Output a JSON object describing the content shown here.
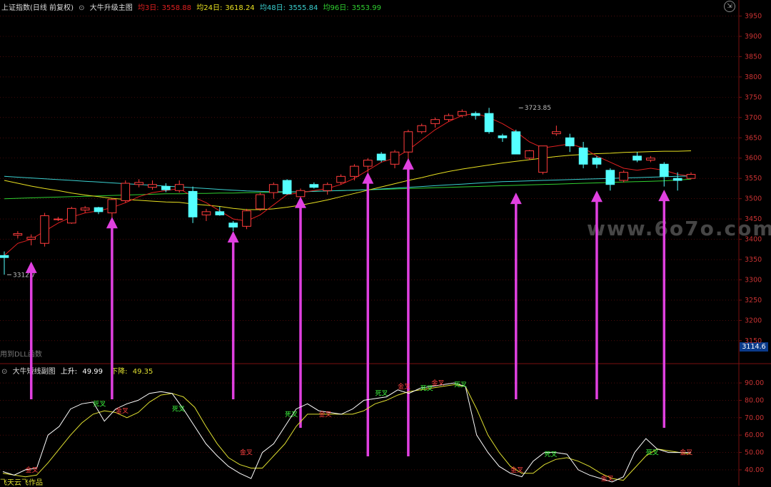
{
  "header": {
    "symbol": "上证指数(日线 前复权)",
    "indicator_main": "大牛升级主图",
    "ma3_label": "均3日:",
    "ma3_value": "3558.88",
    "ma24_label": "均24日:",
    "ma24_value": "3618.24",
    "ma48_label": "均48日:",
    "ma48_value": "3555.84",
    "ma96_label": "均96日:",
    "ma96_value": "3553.99"
  },
  "sub_header": {
    "indicator_sub": "大牛短线副图",
    "up_label": "上升:",
    "up_value": "49.99",
    "down_label": "下降:",
    "down_value": "49.35"
  },
  "watermark": "www.6o7o.com",
  "dll_note": "用到DLL函数",
  "author": "飞天云飞作品",
  "current_price_badge": "3114.6",
  "colors": {
    "up": "#ff3c3c",
    "down": "#54ffff",
    "ma3": "#e02020",
    "ma24": "#e8e020",
    "ma48": "#3ad0d0",
    "ma96": "#30d030",
    "sub_up": "#ffffff",
    "sub_down": "#e0e030",
    "arrow": "#e040e0",
    "grid": "#7a1010"
  },
  "chart_data": [
    {
      "type": "candlestick",
      "y_ticks": [
        3150,
        3200,
        3250,
        3300,
        3350,
        3400,
        3450,
        3500,
        3550,
        3600,
        3650,
        3700,
        3750,
        3800,
        3850,
        3900,
        3950
      ],
      "ylim": [
        3114.6,
        3965
      ],
      "grid": true,
      "annotations": [
        {
          "text": "3723.85",
          "x": 38,
          "y": 3723.85
        },
        {
          "text": "3312.7",
          "x": 0,
          "y": 3312.7
        }
      ],
      "candles": [
        [
          3360,
          3370,
          3312.7,
          3355
        ],
        [
          3410,
          3420,
          3402,
          3414
        ],
        [
          3400,
          3412,
          3385,
          3405
        ],
        [
          3390,
          3465,
          3382,
          3458
        ],
        [
          3450,
          3455,
          3445,
          3450
        ],
        [
          3440,
          3480,
          3438,
          3476
        ],
        [
          3472,
          3482,
          3465,
          3477
        ],
        [
          3478,
          3480,
          3462,
          3468
        ],
        [
          3465,
          3500,
          3450,
          3498
        ],
        [
          3495,
          3545,
          3490,
          3538
        ],
        [
          3535,
          3548,
          3528,
          3540
        ],
        [
          3528,
          3545,
          3522,
          3535
        ],
        [
          3530,
          3538,
          3516,
          3522
        ],
        [
          3520,
          3545,
          3515,
          3535
        ],
        [
          3518,
          3530,
          3440,
          3455
        ],
        [
          3460,
          3475,
          3445,
          3468
        ],
        [
          3468,
          3480,
          3458,
          3460
        ],
        [
          3440,
          3445,
          3420,
          3430
        ],
        [
          3432,
          3475,
          3425,
          3470
        ],
        [
          3475,
          3515,
          3470,
          3510
        ],
        [
          3515,
          3540,
          3500,
          3535
        ],
        [
          3545,
          3548,
          3510,
          3512
        ],
        [
          3505,
          3525,
          3495,
          3520
        ],
        [
          3535,
          3540,
          3525,
          3528
        ],
        [
          3520,
          3540,
          3510,
          3535
        ],
        [
          3540,
          3560,
          3535,
          3555
        ],
        [
          3555,
          3585,
          3545,
          3580
        ],
        [
          3580,
          3600,
          3565,
          3595
        ],
        [
          3610,
          3615,
          3590,
          3595
        ],
        [
          3585,
          3620,
          3575,
          3615
        ],
        [
          3615,
          3670,
          3595,
          3665
        ],
        [
          3665,
          3685,
          3660,
          3680
        ],
        [
          3685,
          3700,
          3675,
          3695
        ],
        [
          3695,
          3710,
          3690,
          3705
        ],
        [
          3705,
          3720,
          3700,
          3715
        ],
        [
          3710,
          3715,
          3695,
          3705
        ],
        [
          3710,
          3723.85,
          3660,
          3665
        ],
        [
          3655,
          3660,
          3640,
          3650
        ],
        [
          3665,
          3670,
          3610,
          3610
        ],
        [
          3600,
          3620,
          3595,
          3618
        ],
        [
          3565,
          3630,
          3560,
          3630
        ],
        [
          3660,
          3680,
          3655,
          3665
        ],
        [
          3650,
          3660,
          3615,
          3630
        ],
        [
          3625,
          3640,
          3575,
          3585
        ],
        [
          3600,
          3605,
          3575,
          3585
        ],
        [
          3570,
          3575,
          3520,
          3535
        ],
        [
          3545,
          3570,
          3540,
          3565
        ],
        [
          3605,
          3615,
          3590,
          3595
        ],
        [
          3595,
          3605,
          3590,
          3600
        ],
        [
          3585,
          3590,
          3530,
          3555
        ],
        [
          3550,
          3565,
          3520,
          3545
        ],
        [
          3550,
          3565,
          3548,
          3560
        ]
      ],
      "ma3": [
        3360,
        3390,
        3400,
        3420,
        3440,
        3455,
        3465,
        3470,
        3478,
        3490,
        3505,
        3515,
        3520,
        3525,
        3505,
        3490,
        3470,
        3450,
        3445,
        3460,
        3485,
        3510,
        3515,
        3520,
        3525,
        3535,
        3550,
        3570,
        3590,
        3600,
        3620,
        3645,
        3670,
        3690,
        3705,
        3710,
        3700,
        3685,
        3665,
        3640,
        3625,
        3630,
        3635,
        3625,
        3605,
        3590,
        3575,
        3570,
        3575,
        3570,
        3560,
        3555
      ],
      "ma24": [
        3545,
        3538,
        3531,
        3525,
        3520,
        3514,
        3509,
        3505,
        3501,
        3498,
        3496,
        3494,
        3492,
        3491,
        3487,
        3484,
        3481,
        3476,
        3473,
        3473,
        3475,
        3479,
        3484,
        3490,
        3497,
        3505,
        3513,
        3521,
        3529,
        3537,
        3545,
        3552,
        3560,
        3567,
        3573,
        3578,
        3583,
        3588,
        3592,
        3596,
        3600,
        3604,
        3607,
        3609,
        3611,
        3612,
        3614,
        3615,
        3616,
        3617,
        3617,
        3618
      ],
      "ma48": [
        3555,
        3553,
        3551,
        3549,
        3547,
        3545,
        3543,
        3541,
        3539,
        3537,
        3535,
        3533,
        3531,
        3529,
        3527,
        3525,
        3523,
        3521,
        3519,
        3518,
        3517,
        3517,
        3517,
        3518,
        3519,
        3520,
        3521,
        3522,
        3524,
        3526,
        3528,
        3530,
        3532,
        3534,
        3536,
        3538,
        3540,
        3542,
        3543,
        3544,
        3545,
        3546,
        3547,
        3548,
        3549,
        3550,
        3551,
        3552,
        3553,
        3554,
        3555,
        3556
      ],
      "ma96": [
        3500,
        3501,
        3502,
        3503,
        3504,
        3505,
        3506,
        3507,
        3508,
        3509,
        3510,
        3511,
        3512,
        3512,
        3513,
        3513,
        3514,
        3514,
        3515,
        3515,
        3516,
        3516,
        3517,
        3518,
        3519,
        3520,
        3521,
        3522,
        3523,
        3524,
        3525,
        3526,
        3527,
        3528,
        3529,
        3530,
        3531,
        3532,
        3533,
        3534,
        3535,
        3536,
        3537,
        3538,
        3539,
        3540,
        3541,
        3542,
        3543,
        3544,
        3546,
        3548
      ],
      "arrows": [
        {
          "x": 2,
          "to": 3345
        },
        {
          "x": 8,
          "to": 3455
        },
        {
          "x": 17,
          "to": 3420
        },
        {
          "x": 22,
          "to": 3505
        },
        {
          "x": 27,
          "to": 3565
        },
        {
          "x": 30,
          "to": 3600
        },
        {
          "x": 38,
          "to": 3515
        },
        {
          "x": 44,
          "to": 3520
        },
        {
          "x": 49,
          "to": 3522
        }
      ]
    },
    {
      "type": "line",
      "y_ticks": [
        40,
        50,
        60,
        70,
        80,
        90
      ],
      "ylim": [
        33,
        97
      ],
      "grid": true,
      "series": [
        {
          "name": "上升",
          "values": [
            39,
            37,
            40,
            41,
            60,
            65,
            75,
            78,
            79,
            68,
            75,
            78,
            80,
            84,
            85,
            84,
            75,
            65,
            55,
            48,
            42,
            38,
            35,
            50,
            55,
            65,
            75,
            78,
            74,
            73,
            72,
            75,
            80,
            81,
            82,
            86,
            84,
            87,
            88,
            89,
            90,
            88,
            60,
            50,
            42,
            38,
            36,
            45,
            50,
            50,
            49,
            40,
            37,
            35,
            33,
            36,
            50,
            58,
            52,
            50,
            50,
            50
          ]
        },
        {
          "name": "下降",
          "values": [
            38,
            37,
            36,
            37,
            44,
            52,
            60,
            67,
            72,
            74,
            73,
            70,
            73,
            79,
            83,
            84,
            82,
            76,
            65,
            55,
            47,
            43,
            41,
            41,
            48,
            55,
            65,
            72,
            72,
            72,
            72,
            72,
            74,
            78,
            80,
            83,
            85,
            86,
            87,
            88,
            89,
            88,
            75,
            60,
            50,
            42,
            38,
            38,
            43,
            46,
            47,
            45,
            42,
            38,
            35,
            34,
            41,
            48,
            52,
            51,
            50,
            49
          ]
        }
      ],
      "cross_labels": [
        {
          "text": "金叉",
          "x": 2,
          "y": 40
        },
        {
          "text": "死叉",
          "x": 8,
          "y": 78
        },
        {
          "text": "金叉",
          "x": 10,
          "y": 74
        },
        {
          "text": "死叉",
          "x": 15,
          "y": 75
        },
        {
          "text": "金叉",
          "x": 21,
          "y": 50
        },
        {
          "text": "死叉",
          "x": 25,
          "y": 72
        },
        {
          "text": "金叉",
          "x": 28,
          "y": 72
        },
        {
          "text": "死叉",
          "x": 33,
          "y": 84
        },
        {
          "text": "金叉",
          "x": 35,
          "y": 88
        },
        {
          "text": "死叉",
          "x": 37,
          "y": 87
        },
        {
          "text": "金叉",
          "x": 38,
          "y": 90
        },
        {
          "text": "死叉",
          "x": 40,
          "y": 89
        },
        {
          "text": "金叉",
          "x": 45,
          "y": 40
        },
        {
          "text": "死叉",
          "x": 48,
          "y": 49
        },
        {
          "text": "金叉",
          "x": 53,
          "y": 35
        },
        {
          "text": "死叉",
          "x": 57,
          "y": 50
        },
        {
          "text": "金叉",
          "x": 60,
          "y": 50
        }
      ]
    }
  ]
}
